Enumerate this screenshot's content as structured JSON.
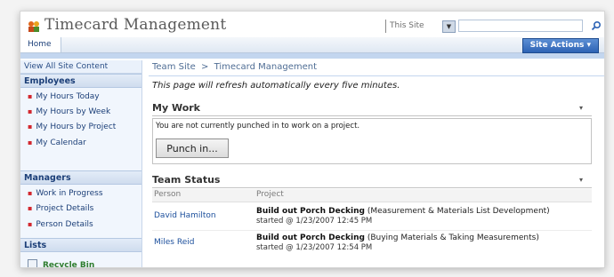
{
  "header": {
    "site_title": "Timecard Management",
    "search_scope": "This Site",
    "search_value": ""
  },
  "topnav": {
    "home_tab": "Home",
    "site_actions": "Site Actions ▾"
  },
  "leftnav": {
    "view_all": "View All Site Content",
    "sections": [
      {
        "title": "Employees",
        "items": [
          "My Hours Today",
          "My Hours by Week",
          "My Hours by Project",
          "My Calendar"
        ]
      },
      {
        "title": "Managers",
        "items": [
          "Work in Progress",
          "Project Details",
          "Person Details"
        ]
      },
      {
        "title": "Lists",
        "items": []
      }
    ],
    "recycle_bin": "Recycle Bin"
  },
  "main": {
    "breadcrumb": [
      "Team Site",
      "Timecard Management"
    ],
    "breadcrumb_separator": ">",
    "refresh_note": "This page will refresh automatically every five minutes.",
    "my_work": {
      "title": "My Work",
      "message": "You are not currently punched in to work on a project.",
      "punch_button": "Punch in..."
    },
    "team_status": {
      "title": "Team Status",
      "columns": [
        "Person",
        "Project"
      ],
      "rows": [
        {
          "person": "David Hamilton",
          "project": "Build out Porch Decking",
          "task": "(Measurement & Materials List Development)",
          "started": "started @ 1/23/2007 12:45 PM"
        },
        {
          "person": "Miles Reid",
          "project": "Build out Porch Decking",
          "task": "(Buying Materials & Taking Measurements)",
          "started": "started @ 1/23/2007 12:54 PM"
        }
      ]
    }
  },
  "colors": {
    "accent": "#2d63b5",
    "link": "#1c4f9c",
    "nav_bg": "#f1f6fd",
    "bullet": "#d2272e",
    "recycle": "#2f7d2f"
  },
  "icons": {
    "site_logo": "people-logo-icon",
    "search": "search-icon",
    "recycle": "recycle-bin-icon",
    "menu": "chevron-down-icon"
  }
}
